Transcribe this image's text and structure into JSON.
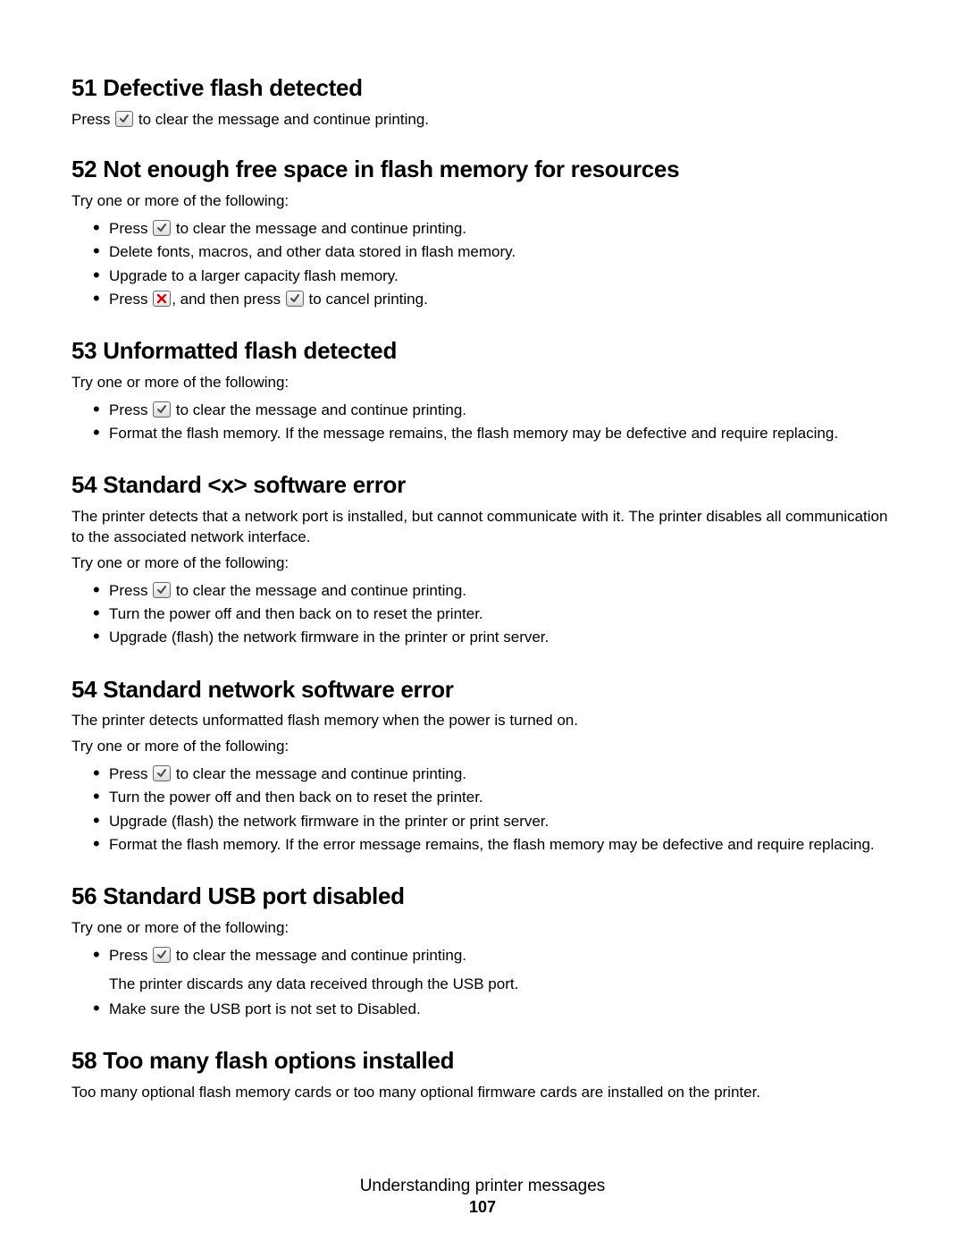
{
  "footer": {
    "title": "Understanding printer messages",
    "page": "107"
  },
  "s51": {
    "heading": "51 Defective flash detected",
    "press_pre": "Press ",
    "press_post": " to clear the message and continue printing."
  },
  "s52": {
    "heading": "52 Not enough free space in flash memory for resources",
    "intro": "Try one or more of the following:",
    "b0_pre": "Press ",
    "b0_post": " to clear the message and continue printing.",
    "b1": "Delete fonts, macros, and other data stored in flash memory.",
    "b2": "Upgrade to a larger capacity flash memory.",
    "b3_pre": "Press ",
    "b3_mid": ", and then press ",
    "b3_post": " to cancel printing."
  },
  "s53": {
    "heading": "53 Unformatted flash detected",
    "intro": "Try one or more of the following:",
    "b0_pre": "Press ",
    "b0_post": " to clear the message and continue printing.",
    "b1": "Format the flash memory. If the message remains, the flash memory may be defective and require replacing."
  },
  "s54a": {
    "heading": "54 Standard <x> software error",
    "desc": "The printer detects that a network port is installed, but cannot communicate with it. The printer disables all communication to the associated network interface.",
    "intro": "Try one or more of the following:",
    "b0_pre": "Press ",
    "b0_post": " to clear the message and continue printing.",
    "b1": "Turn the power off and then back on to reset the printer.",
    "b2": "Upgrade (flash) the network firmware in the printer or print server."
  },
  "s54b": {
    "heading": "54 Standard network software error",
    "desc": "The printer detects unformatted flash memory when the power is turned on.",
    "intro": "Try one or more of the following:",
    "b0_pre": "Press ",
    "b0_post": " to clear the message and continue printing.",
    "b1": "Turn the power off and then back on to reset the printer.",
    "b2": "Upgrade (flash) the network firmware in the printer or print server.",
    "b3": "Format the flash memory. If the error message remains, the flash memory may be defective and require replacing."
  },
  "s56": {
    "heading": "56 Standard USB port disabled",
    "intro": "Try one or more of the following:",
    "b0_pre": "Press ",
    "b0_post": " to clear the message and continue printing.",
    "b0_note": "The printer discards any data received through the USB port.",
    "b1": "Make sure the USB port is not set to Disabled."
  },
  "s58": {
    "heading": "58 Too many flash options installed",
    "desc": "Too many optional flash memory cards or too many optional firmware cards are installed on the printer."
  }
}
